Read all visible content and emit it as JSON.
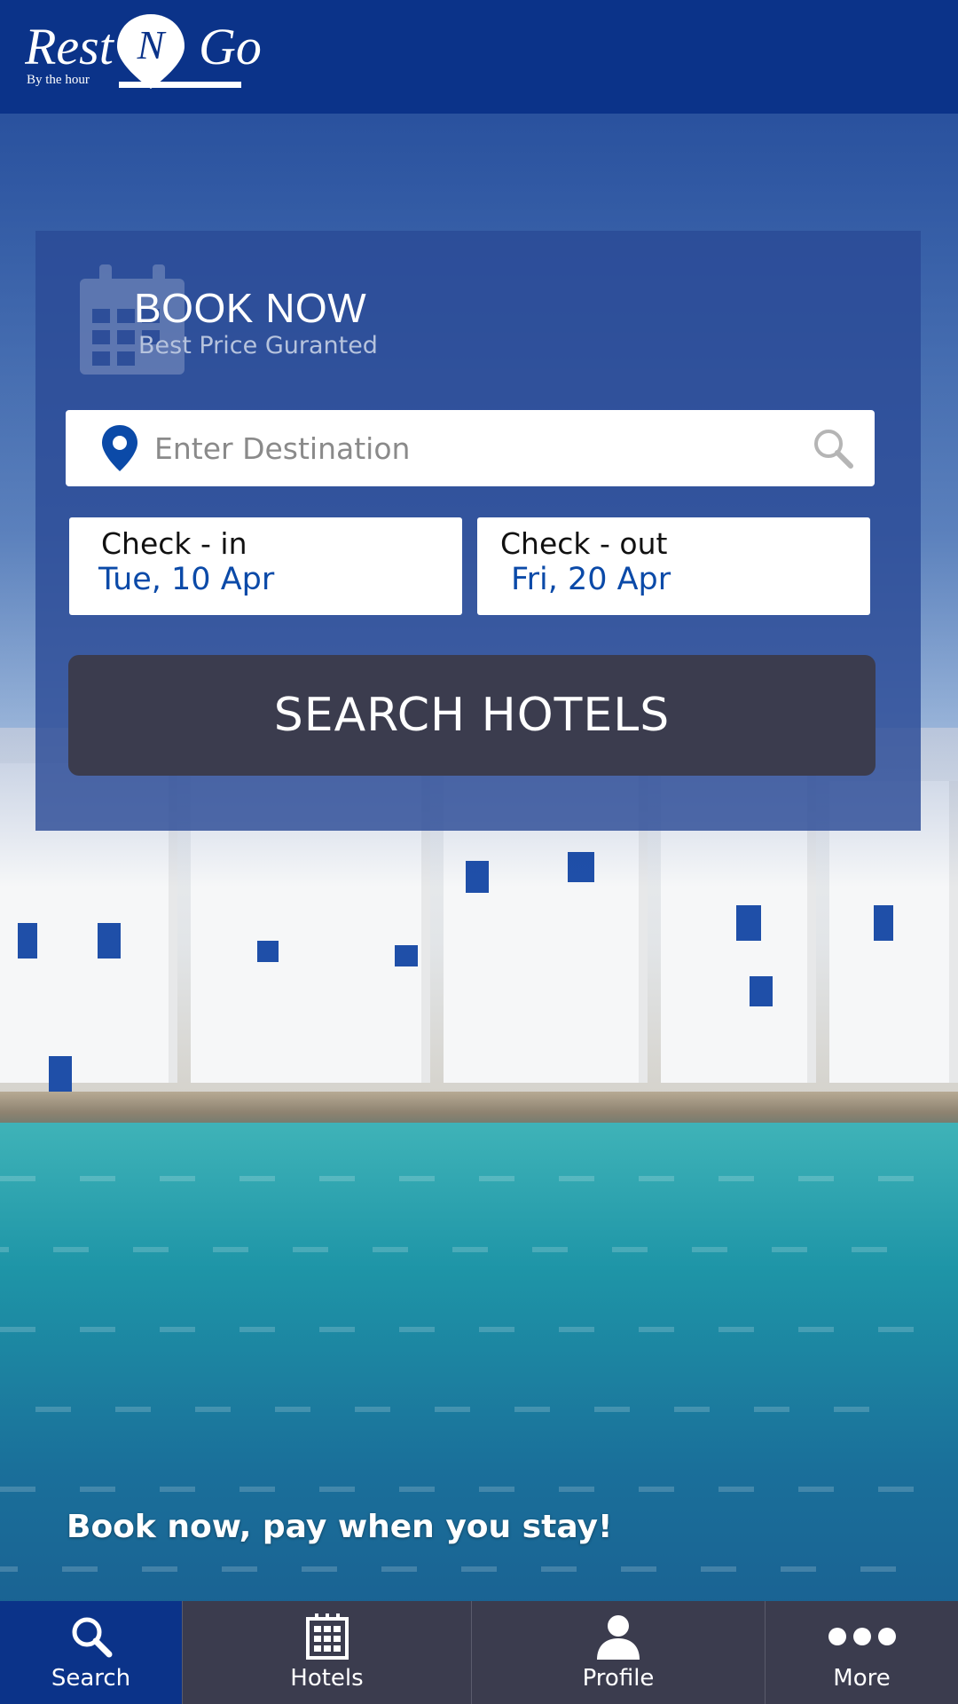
{
  "header": {
    "logo_main_left": "Rest",
    "logo_main_mid": "N",
    "logo_main_right": "Go",
    "logo_tagline": "By the hour"
  },
  "booking": {
    "title": "BOOK NOW",
    "subtitle": "Best Price Guranted",
    "destination_placeholder": "Enter Destination",
    "destination_value": "",
    "checkin_label": "Check - in",
    "checkin_value": "Tue, 10 Apr",
    "checkout_label": "Check - out",
    "checkout_value": "Fri, 20 Apr",
    "search_button": "SEARCH HOTELS"
  },
  "tagline": "Book now, pay when you stay!",
  "nav": {
    "items": [
      {
        "label": "Search",
        "icon": "search-icon",
        "active": true
      },
      {
        "label": "Hotels",
        "icon": "building-icon",
        "active": false
      },
      {
        "label": "Profile",
        "icon": "user-icon",
        "active": false
      },
      {
        "label": "More",
        "icon": "more-dots-icon",
        "active": false
      }
    ]
  },
  "colors": {
    "header_bg": "#0b3389",
    "card_bg": "#2b4b96",
    "button_bg": "#3b3c4e",
    "date_text": "#0b4aa8",
    "nav_active": "#0b3389"
  }
}
